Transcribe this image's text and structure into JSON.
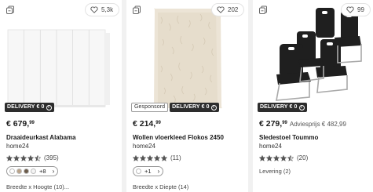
{
  "products": [
    {
      "favorites": "5,3k",
      "badges": {
        "delivery": "DELIVERY € 0",
        "sponsored": ""
      },
      "price_main": "€ 679,",
      "price_cents": "99",
      "advice": "",
      "title": "Draaideurkast Alabama",
      "seller": "home24",
      "rating": 4.5,
      "rating_count": "(395)",
      "variants_more": "+8",
      "extra": "Breedte x Hoogte (10)..."
    },
    {
      "favorites": "202",
      "badges": {
        "delivery": "DELIVERY € 0",
        "sponsored": "Gesponsord"
      },
      "price_main": "€ 214,",
      "price_cents": "99",
      "advice": "",
      "title": "Wollen vloerkleed Flokos 2450",
      "seller": "home24",
      "rating": 5,
      "rating_count": "(11)",
      "variants_more": "+1",
      "extra": "Breedte x Diepte (14)"
    },
    {
      "favorites": "99",
      "badges": {
        "delivery": "DELIVERY € 0",
        "sponsored": ""
      },
      "price_main": "€ 279,",
      "price_cents": "99",
      "advice": "Adviesprijs € 482,99",
      "title": "Sledestoel Toummo",
      "seller": "home24",
      "rating": 4.5,
      "rating_count": "(20)",
      "variants_more": "",
      "extra": "Levering (2)"
    }
  ],
  "icons": {
    "compare": "compare-icon",
    "favorite": "heart-icon",
    "info": "info-icon",
    "star": "star-icon",
    "chevron": "chevron-right-icon"
  },
  "colors": {
    "delivery_badge": "#2d2d2d",
    "star": "#555555",
    "text": "#1a1a1a"
  }
}
